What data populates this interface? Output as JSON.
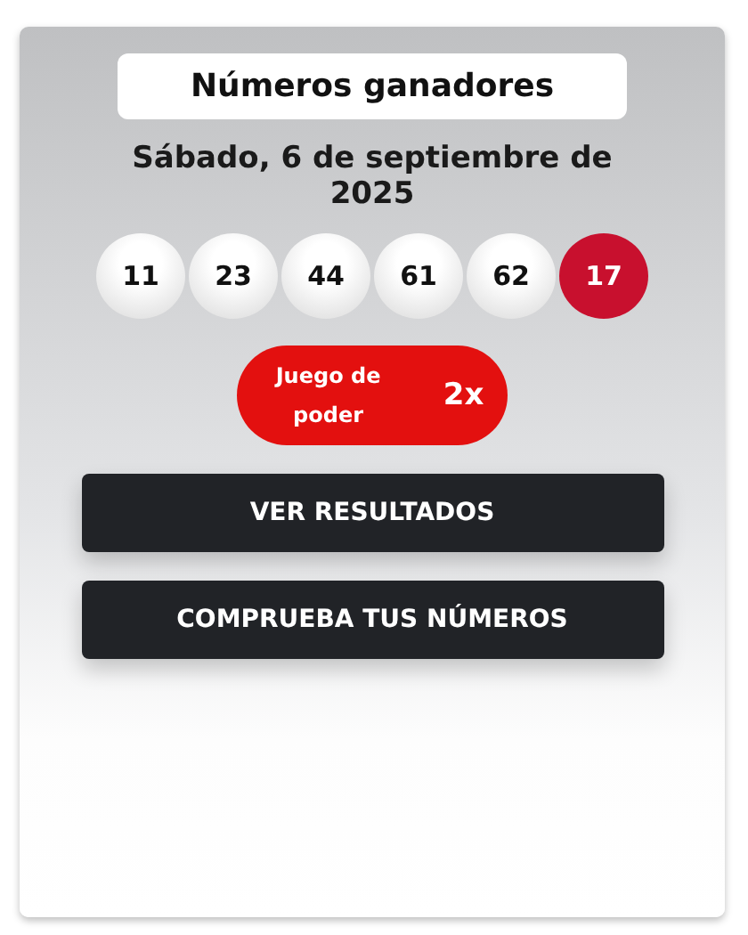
{
  "title": "Números ganadores",
  "date": "Sábado, 6 de septiembre de 2025",
  "balls": [
    {
      "number": "11",
      "kind": "white"
    },
    {
      "number": "23",
      "kind": "white"
    },
    {
      "number": "44",
      "kind": "white"
    },
    {
      "number": "61",
      "kind": "white"
    },
    {
      "number": "62",
      "kind": "white"
    },
    {
      "number": "17",
      "kind": "power"
    }
  ],
  "power_play": {
    "label": "Juego de poder",
    "multiplier": "2x"
  },
  "buttons": [
    "VER RESULTADOS",
    "COMPRUEBA TUS NÚMEROS"
  ]
}
